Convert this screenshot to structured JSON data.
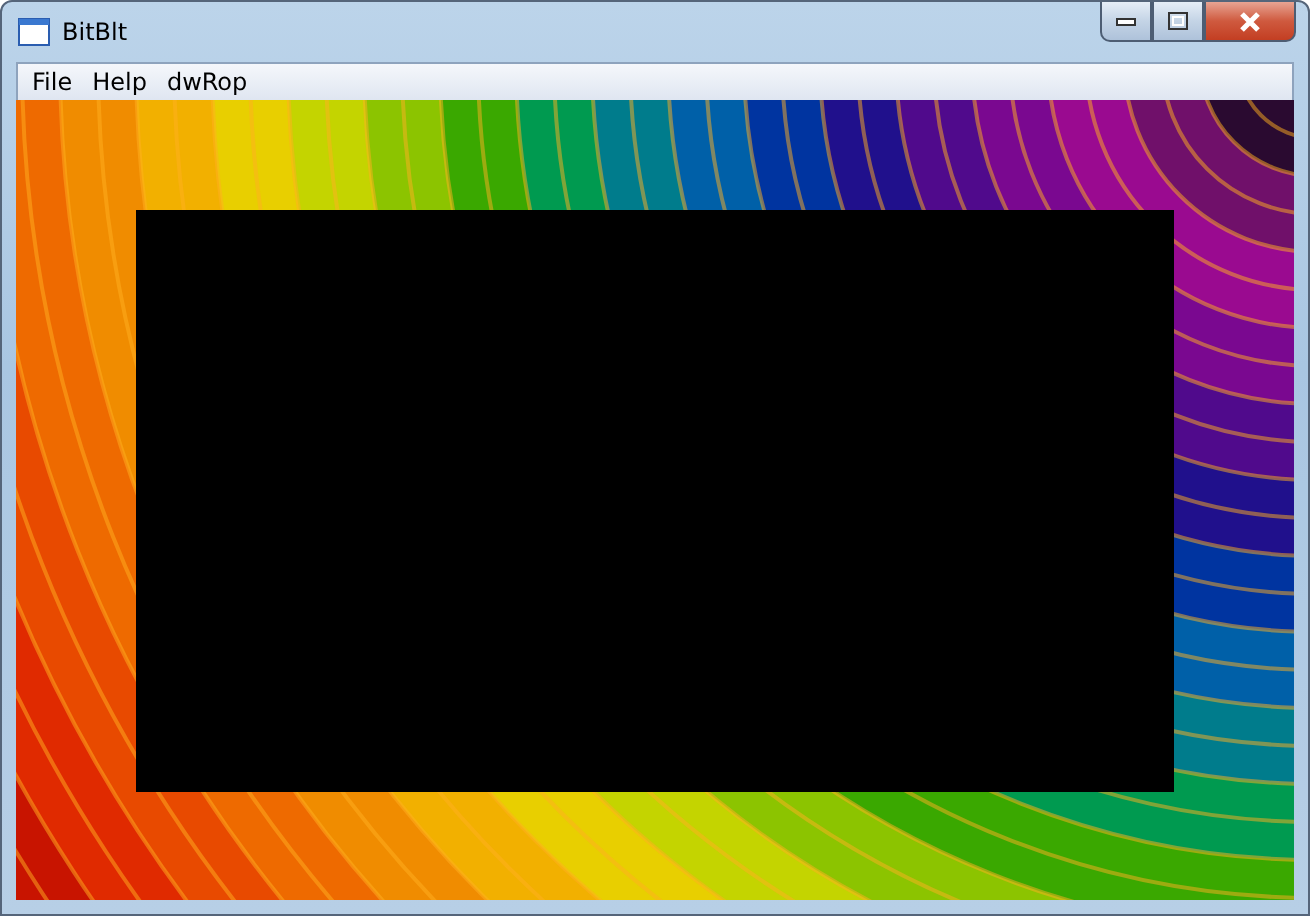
{
  "window": {
    "title": "BitBlt"
  },
  "menu": [
    {
      "label": "File"
    },
    {
      "label": "Help"
    },
    {
      "label": "dwRop"
    }
  ]
}
